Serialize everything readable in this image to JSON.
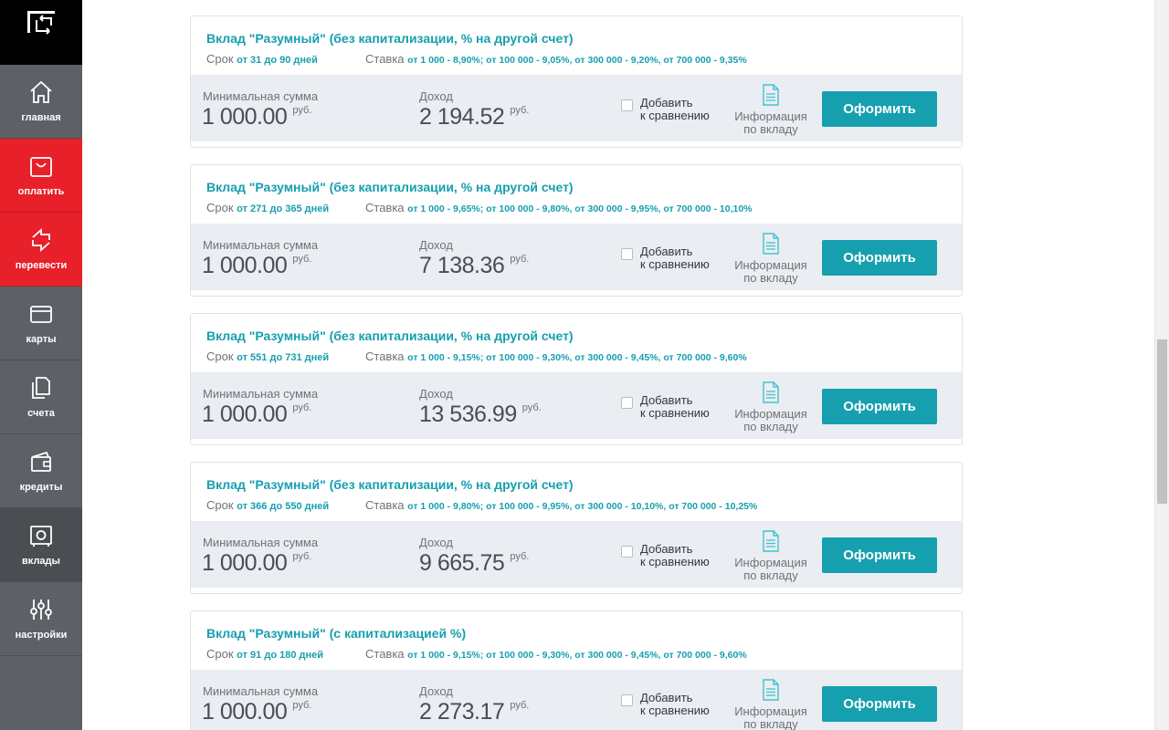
{
  "sidebar": {
    "items": [
      {
        "label": "главная",
        "icon": "home-icon"
      },
      {
        "label": "оплатить",
        "icon": "shopping-bag-icon"
      },
      {
        "label": "перевести",
        "icon": "transfer-icon"
      },
      {
        "label": "карты",
        "icon": "card-icon"
      },
      {
        "label": "счета",
        "icon": "documents-icon"
      },
      {
        "label": "кредиты",
        "icon": "wallet-icon"
      },
      {
        "label": "вклады",
        "icon": "safe-icon"
      },
      {
        "label": "настройки",
        "icon": "sliders-icon"
      }
    ]
  },
  "colors": {
    "accent": "#169faf",
    "red": "#e8202a",
    "sidebar": "#5d6066"
  },
  "labels": {
    "term": "Срок",
    "rate": "Ставка",
    "min_sum": "Минимальная сумма",
    "income": "Доход",
    "currency": "руб.",
    "compare_line1": "Добавить",
    "compare_line2": "к сравнению",
    "info_line1": "Информация",
    "info_line2": "по вкладу",
    "apply": "Оформить"
  },
  "deposits": [
    {
      "title": "Вклад \"Разумный\" (без капитализации, % на другой счет)",
      "term": "от 31 до 90 дней",
      "rate": "от 1 000 - 8,90%; от 100 000 - 9,05%, от 300 000 - 9,20%, от 700 000 - 9,35%",
      "min_sum": "1 000.00",
      "income": "2 194.52"
    },
    {
      "title": "Вклад \"Разумный\" (без капитализации, % на другой счет)",
      "term": "от 271 до 365 дней",
      "rate": "от 1 000 - 9,65%; от 100 000 - 9,80%, от 300 000 - 9,95%, от 700 000 - 10,10%",
      "min_sum": "1 000.00",
      "income": "7 138.36"
    },
    {
      "title": "Вклад \"Разумный\" (без капитализации, % на другой счет)",
      "term": "от 551 до 731 дней",
      "rate": "от 1 000 - 9,15%; от 100 000 - 9,30%, от 300 000 - 9,45%, от 700 000 - 9,60%",
      "min_sum": "1 000.00",
      "income": "13 536.99"
    },
    {
      "title": "Вклад \"Разумный\" (без капитализации, % на другой счет)",
      "term": "от 366 до 550 дней",
      "rate": "от 1 000 - 9,80%; от 100 000 - 9,95%, от 300 000 - 10,10%, от 700 000 - 10,25%",
      "min_sum": "1 000.00",
      "income": "9 665.75"
    },
    {
      "title": "Вклад \"Разумный\" (с капитализацией %)",
      "term": "от 91 до 180 дней",
      "rate": "от 1 000 - 9,15%; от 100 000 - 9,30%, от 300 000 - 9,45%, от 700 000 - 9,60%",
      "min_sum": "1 000.00",
      "income": "2 273.17"
    }
  ]
}
